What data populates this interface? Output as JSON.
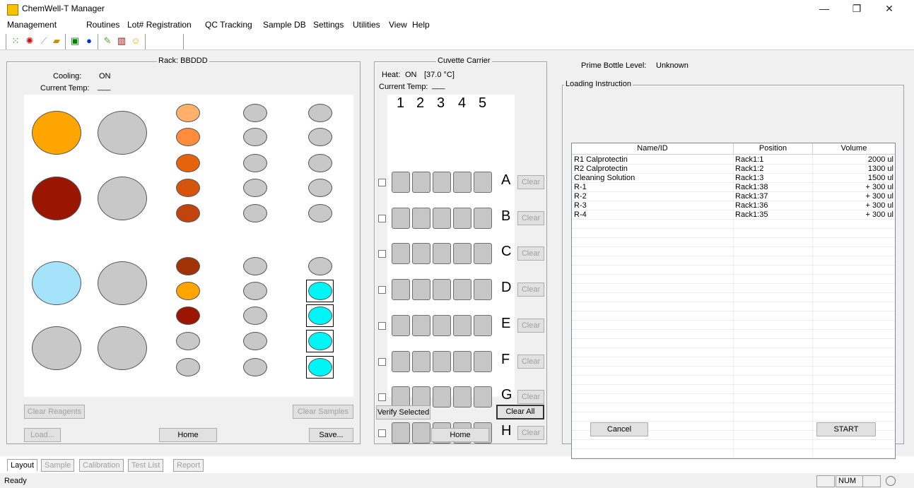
{
  "window": {
    "title": "ChemWell-T Manager",
    "minimize": "—",
    "restore": "❐",
    "close": "✕"
  },
  "menu": [
    "Management",
    "Routines",
    "Lot# Registration",
    "QC Tracking",
    "Sample DB",
    "Settings",
    "Utilities",
    "View",
    "Help"
  ],
  "toolbar_icons": [
    "grid-icon",
    "gear-icon",
    "pipette-icon",
    "folder-icon",
    "monitor-icon",
    "info-icon",
    "edit-icon",
    "chart-icon",
    "smiley-icon"
  ],
  "rack": {
    "title": "Rack: BBDDD",
    "cooling_label": "Cooling:",
    "cooling_value": "ON",
    "temp_label": "Current Temp:",
    "temp_value": "___",
    "clear_reagents": "Clear Reagents",
    "clear_samples": "Clear Samples",
    "load": "Load...",
    "home": "Home",
    "save": "Save...",
    "colors": {
      "orange": "#ffa500",
      "darkred": "#9b1600",
      "lightblue": "#a4e3f9",
      "gray": "#c8c8c8",
      "cyan": "#00f6f6",
      "peach": "#ffb06a",
      "lightorange": "#ff8c3c",
      "burnt": "#e3640c",
      "rust": "#d5550e",
      "brick": "#c0440c",
      "brown": "#a03308"
    }
  },
  "cuvette": {
    "title": "Cuvette Carrier",
    "heat_label": "Heat:",
    "heat_value": "ON",
    "heat_temp": "[37.0 °C]",
    "temp_label": "Current Temp:",
    "temp_value": "___",
    "columns": [
      "1",
      "2",
      "3",
      "4",
      "5"
    ],
    "rows": [
      "A",
      "B",
      "C",
      "D",
      "E",
      "F",
      "G",
      "H"
    ],
    "clear_label": "Clear",
    "verify_selected": "Verify Selected",
    "clear_all": "Clear All",
    "home": "Home"
  },
  "loading": {
    "prime_label": "Prime Bottle Level:",
    "prime_value": "Unknown",
    "group_title": "Loading Instruction",
    "columns": [
      "Name/ID",
      "Position",
      "Volume"
    ],
    "rows": [
      {
        "name": "R1 Calprotectin",
        "position": "Rack1:1",
        "volume": "2000 ul"
      },
      {
        "name": "R2 Calprotectin",
        "position": "Rack1:2",
        "volume": "1300 ul"
      },
      {
        "name": "Cleaning Solution",
        "position": "Rack1:3",
        "volume": "1500 ul"
      },
      {
        "name": "R-1",
        "position": "Rack1:38",
        "volume": "+ 300 ul"
      },
      {
        "name": "R-2",
        "position": "Rack1:37",
        "volume": "+ 300 ul"
      },
      {
        "name": "R-3",
        "position": "Rack1:36",
        "volume": "+ 300 ul"
      },
      {
        "name": "R-4",
        "position": "Rack1:35",
        "volume": "+ 300 ul"
      }
    ],
    "cancel": "Cancel",
    "start": "START"
  },
  "tabs": [
    "Layout",
    "Sample",
    "Calibration",
    "Test List",
    "Report"
  ],
  "status": {
    "text": "Ready",
    "num": "NUM"
  }
}
